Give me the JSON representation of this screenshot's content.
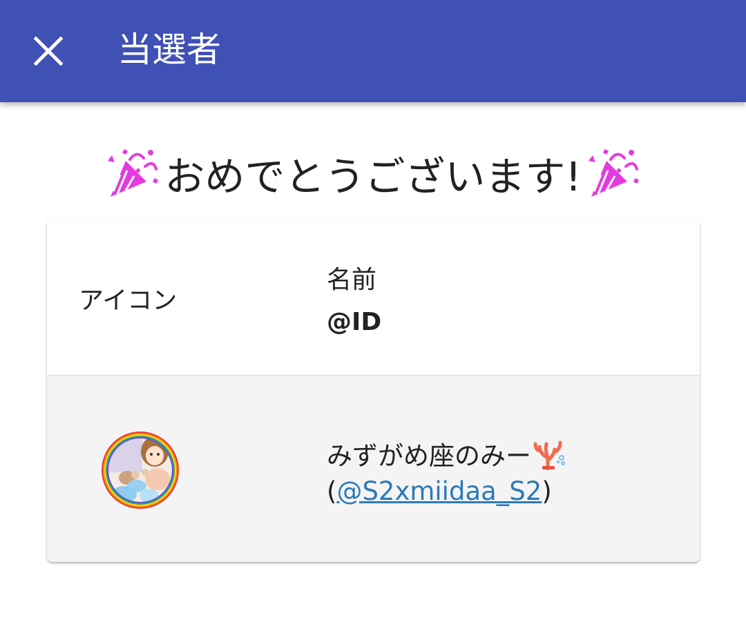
{
  "appbar": {
    "title": "当選者",
    "close_icon": "close-icon",
    "background_color": "#3f51b5"
  },
  "congrats": {
    "text": "おめでとうございます!",
    "left_icon": "party-popper-icon",
    "right_icon": "party-popper-icon"
  },
  "table": {
    "headers": {
      "icon": "アイコン",
      "name": "名前",
      "id": "@ID"
    },
    "rows": [
      {
        "avatar": "winner-avatar",
        "name": "みずがめ座のみー",
        "name_emoji": "coral-icon",
        "id_open": "(",
        "id_link": "@S2xmiidaa_S2",
        "id_close": ")"
      }
    ]
  },
  "colors": {
    "link": "#2a7ab8",
    "row_background": "#f4f4f4"
  }
}
